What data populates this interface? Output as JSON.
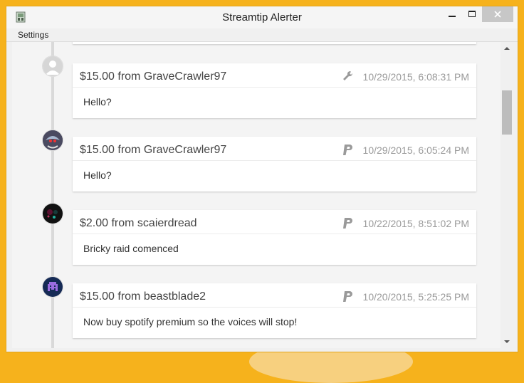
{
  "window": {
    "title": "Streamtip Alerter",
    "menu": {
      "settings_label": "Settings"
    }
  },
  "tips": [
    {
      "amount": "$15.00 from GraveCrawler97",
      "source_icon": "wrench-icon",
      "date": "10/29/2015, 6:08:31 PM",
      "message": "Hello?"
    },
    {
      "amount": "$15.00 from GraveCrawler97",
      "source_icon": "paypal-icon",
      "date": "10/29/2015, 6:05:24 PM",
      "message": "Hello?"
    },
    {
      "amount": "$2.00 from scaierdread",
      "source_icon": "paypal-icon",
      "date": "10/22/2015, 8:51:02 PM",
      "message": "Bricky raid comenced"
    },
    {
      "amount": "$15.00 from beastblade2",
      "source_icon": "paypal-icon",
      "date": "10/20/2015, 5:25:25 PM",
      "message": "Now buy spotify premium so the voices will stop!"
    }
  ],
  "colors": {
    "desktop_bg": "#f6b21c",
    "window_border": "#e3a41a",
    "close_button": "#c7c7c7",
    "source_icon": "#9a9a9a"
  }
}
